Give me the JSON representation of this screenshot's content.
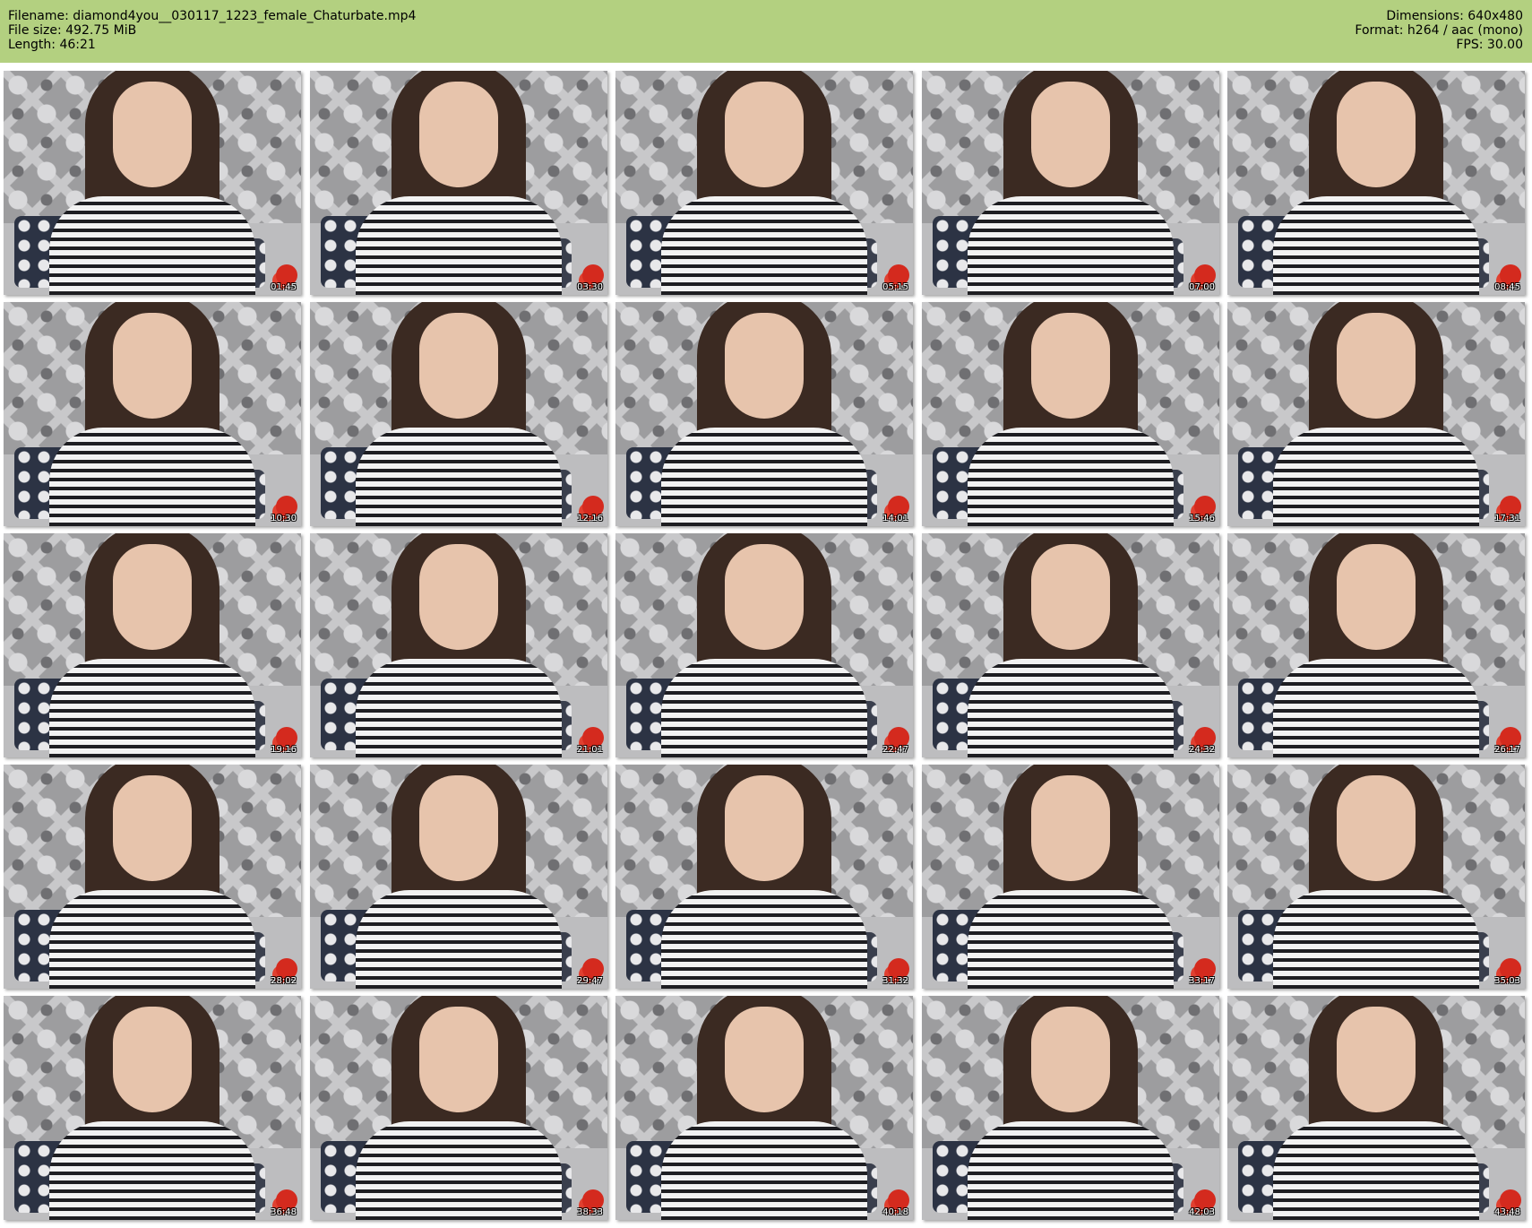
{
  "header": {
    "filename_line": "Filename: diamond4you__030117_1223_female_Chaturbate.mp4",
    "filesize_line": "File size: 492.75 MiB",
    "length_line": "Length: 46:21",
    "dimensions_line": "Dimensions: 640x480",
    "format_line": "Format: h264 / aac (mono)",
    "fps_line": "FPS: 30.00",
    "background_color": "#b3d080"
  },
  "thumbnails": [
    {
      "timestamp": "01:45"
    },
    {
      "timestamp": "03:30"
    },
    {
      "timestamp": "05:15"
    },
    {
      "timestamp": "07:00"
    },
    {
      "timestamp": "08:45"
    },
    {
      "timestamp": "10:30"
    },
    {
      "timestamp": "12:16"
    },
    {
      "timestamp": "14:01"
    },
    {
      "timestamp": "15:46"
    },
    {
      "timestamp": "17:31"
    },
    {
      "timestamp": "19:16"
    },
    {
      "timestamp": "21:01"
    },
    {
      "timestamp": "22:47"
    },
    {
      "timestamp": "24:32"
    },
    {
      "timestamp": "26:17"
    },
    {
      "timestamp": "28:02"
    },
    {
      "timestamp": "29:47"
    },
    {
      "timestamp": "31:32"
    },
    {
      "timestamp": "33:17"
    },
    {
      "timestamp": "35:03"
    },
    {
      "timestamp": "36:48"
    },
    {
      "timestamp": "38:33"
    },
    {
      "timestamp": "40:18"
    },
    {
      "timestamp": "42:03"
    },
    {
      "timestamp": "43:48"
    }
  ]
}
